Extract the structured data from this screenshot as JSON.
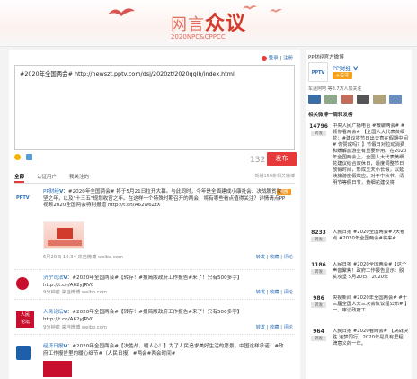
{
  "banner": {
    "title_a": "网言",
    "title_b": "众议",
    "subtitle": "2020NPC&CPPCC"
  },
  "topbar": {
    "login": "登录",
    "sep": "|",
    "register": "注册"
  },
  "compose": {
    "text": "#2020年全国两会# http://newszt.pptv.com/dsj/2020zt/2020qglh/index.html",
    "counter": "132",
    "publish": "发布"
  },
  "tabs": {
    "all": "全部",
    "verified": "认证用户",
    "following": "我关注的",
    "hint": "新增159条相关微博"
  },
  "posts": [
    {
      "author": "PP财经",
      "badge": "热搜",
      "text": "#2020年全国两会# 将于5月21日拉开大幕。与此同时，今年是全面建成小康社会、决战脱贫攻坚之年，以及\"十三五\"规划收官之年。在这样一个特殊时期召开的两会，将有哪些看点值得关注？详情请点PP视频2020全国两会特别报道 http://t.cn/A62w6ZtX",
      "meta": "5月20日 16:34 来自微博 weibo.com",
      "forward": "转发",
      "fav": "收藏",
      "comment": "评论"
    },
    {
      "author": "济宁司法",
      "text": "#2020年全国两会#【转存！#报简版政府工作报告#来了！只有500多字】http://t.cn/A62yJRV0",
      "meta": "9分钟前 来自微博 weibo.com",
      "forward": "转发",
      "fav": "收藏",
      "comment": "评论"
    },
    {
      "author": "人民论坛",
      "text": "#2020年全国两会#【转存！#报简版政府工作报告#来了！只有500多字】http://t.cn/A62yJRV0",
      "meta": "9分钟前 来自微博 weibo.com",
      "forward": "转发",
      "fav": "收藏",
      "comment": "评论"
    },
    {
      "author": "经济日报",
      "text": "#2020年全国两会#【决胜战，暖人心！】为了人民追求美好生活的愿景，中国这样承诺！#政府工作报告里的暖心细节#（人民日报）#两会#两会时间#",
      "meta": "6分钟前 来自微博 weibo.com",
      "forward": "转发",
      "fav": "收藏",
      "comment": "评论"
    }
  ],
  "side": {
    "account_title": "PP财经官方微博",
    "account_name": "PP财经",
    "follow": "+关注",
    "stats": "车迷阿呵 等3.7万人加关注",
    "ranking_title": "相关微博一周转发榜",
    "items": [
      {
        "count": "14796",
        "label": "转发",
        "text": "中央人民广播电台 #微聊两会# #领你看两会# 【全国人大代表黄细花：#建议将节日出天直在假期中间# 你赞成吗？】节假日对拉动消费和缓解旅游业有重要作用。在2020年全国两会上，全国人大代表黄细花建议结合双休日，适度调整节日放假时间，形成五天小长假，以延续旅游度假效应。对于中秋节、清明节等假日节，黄细花建议将"
      },
      {
        "count": "8233",
        "label": "转发",
        "text": "人民日报 #2020全国两会#7大看点 #2020年全国两会#将来#"
      },
      {
        "count": "1186",
        "label": "转发",
        "text": "人民日报 #2020全国两会#【这个声音聚焦！政府工作报告显示：脱贫攻坚 5月20日、2020年"
      },
      {
        "count": "986",
        "label": "转发",
        "text": "央视新闻 #2020年全国两会# #十三届全国人大三次会议议程公布# 】一、审议政府工"
      },
      {
        "count": "964",
        "label": "转发",
        "text": "人民日报 #2020看两会# 【决战决胜 追梦同行】2020年是具有里程碑意义的一年。"
      }
    ]
  },
  "colors": {
    "accent": "#e8393a",
    "link": "#2a6fb8",
    "title": "#d23a2b"
  }
}
